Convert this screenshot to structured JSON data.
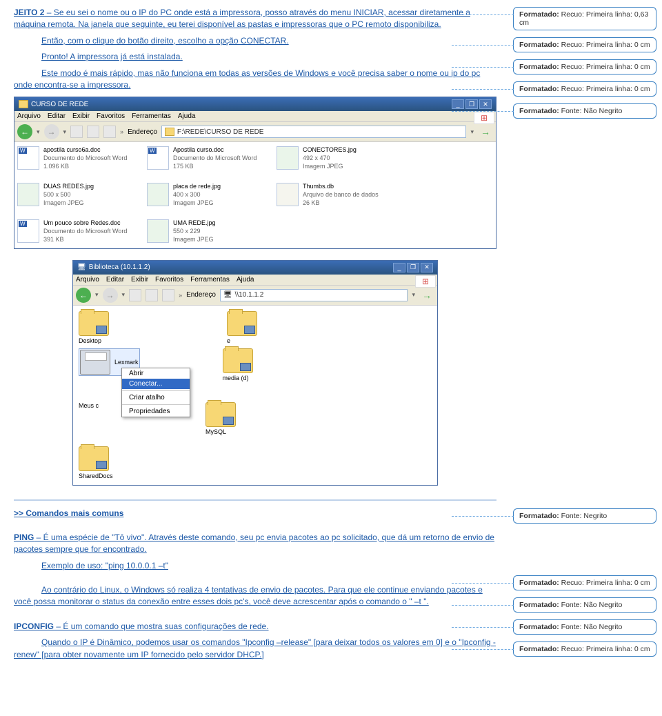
{
  "doc": {
    "jeito2_label": "JEITO 2",
    "jeito2_text": " – Se eu sei o nome ou o IP do PC onde está a impressora, posso através do menu INICIAR, acessar diretamente a máquina remota. Na janela que seguinte, eu terei disponível as pastas e impressoras que o PC remoto disponibiliza.",
    "entao_text": "Então, com o clique do botão direito, escolho a opção CONECTAR.",
    "pronto_text": "Pronto! A impressora já está instalada.",
    "este_modo_text": "Este modo é mais rápido, mas não funciona em todas as versões de Windows e você precisa saber o nome ou ip do pc onde encontra-se a impressora.",
    "comandos_title": ">> Comandos mais comuns",
    "ping_label": "PING",
    "ping_text": " – É uma espécie de \"Tô vivo\". Através deste comando, seu pc envia pacotes ao pc solicitado, que dá um retorno de envio de pacotes sempre que for encontrado.",
    "ping_exemplo": "Exemplo de uso: \"ping 10.0.0.1 –t\"",
    "ping_cont": "Ao contrário do Linux, o Windows só realiza 4 tentativas de envio de pacotes. Para que ele continue enviando pacotes e você possa monitorar o status da conexão entre esses dois pc's, você deve acrescentar após o comando o \" –t \".",
    "ipconfig_label": "IPCONFIG",
    "ipconfig_text": " – É um comando que mostra suas configurações de rede.",
    "ipconfig_cont": "Quando o IP é Dinâmico, podemos usar os comandos \"Ipconfig –release\" [para deixar todos os valores em 0] e o \"Ipconfig -renew\" [para obter novamente um IP fornecido pelo servidor DHCP.]"
  },
  "comments": [
    {
      "label": "Formatado:",
      "text": " Recuo: Primeira linha: 0,63 cm"
    },
    {
      "label": "Formatado:",
      "text": " Recuo: Primeira linha: 0 cm"
    },
    {
      "label": "Formatado:",
      "text": " Recuo: Primeira linha: 0 cm"
    },
    {
      "label": "Formatado:",
      "text": " Recuo: Primeira linha: 0 cm"
    },
    {
      "label": "Formatado:",
      "text": " Fonte: Não Negrito"
    },
    {
      "label": "Formatado:",
      "text": " Fonte: Negrito"
    },
    {
      "label": "Formatado:",
      "text": " Recuo: Primeira linha: 0 cm"
    },
    {
      "label": "Formatado:",
      "text": " Fonte: Não Negrito"
    },
    {
      "label": "Formatado:",
      "text": " Fonte: Não Negrito"
    },
    {
      "label": "Formatado:",
      "text": " Recuo: Primeira linha: 0 cm"
    }
  ],
  "explorer1": {
    "title": "CURSO DE REDE",
    "menu": [
      "Arquivo",
      "Editar",
      "Exibir",
      "Favoritos",
      "Ferramentas",
      "Ajuda"
    ],
    "address_label": "Endereço",
    "address": "F:\\REDE\\CURSO DE REDE",
    "files": [
      {
        "name": "apostila curso6a.doc",
        "desc": "Documento do Microsoft Word",
        "size": "1.096 KB",
        "type": "word"
      },
      {
        "name": "Apostila curso.doc",
        "desc": "Documento do Microsoft Word",
        "size": "175 KB",
        "type": "word"
      },
      {
        "name": "CONECTORES.jpg",
        "desc": "492 x 470",
        "size": "Imagem JPEG",
        "type": "jpg"
      },
      {
        "name": "DUAS REDES.jpg",
        "desc": "500 x 500",
        "size": "Imagem JPEG",
        "type": "jpg"
      },
      {
        "name": "placa de rede.jpg",
        "desc": "400 x 300",
        "size": "Imagem JPEG",
        "type": "jpg"
      },
      {
        "name": "Thumbs.db",
        "desc": "Arquivo de banco de dados",
        "size": "26 KB",
        "type": "db"
      },
      {
        "name": "Um pouco sobre Redes.doc",
        "desc": "Documento do Microsoft Word",
        "size": "391 KB",
        "type": "word"
      },
      {
        "name": "UMA REDE.jpg",
        "desc": "550 x 229",
        "size": "Imagem JPEG",
        "type": "jpg"
      }
    ]
  },
  "explorer2": {
    "title": "Biblioteca (10.1.1.2)",
    "menu": [
      "Arquivo",
      "Editar",
      "Exibir",
      "Favoritos",
      "Ferramentas",
      "Ajuda"
    ],
    "address_label": "Endereço",
    "address": "\\\\10.1.1.2",
    "folders_row1": [
      "Desktop",
      "e"
    ],
    "printer": "Lexmark",
    "folders_row2_right": "media (d)",
    "meus_label": "Meus c",
    "folders_row3_right": "MySQL",
    "shared": "SharedDocs",
    "ctxmenu": [
      "Abrir",
      "Conectar...",
      "Criar atalho",
      "Propriedades"
    ]
  }
}
